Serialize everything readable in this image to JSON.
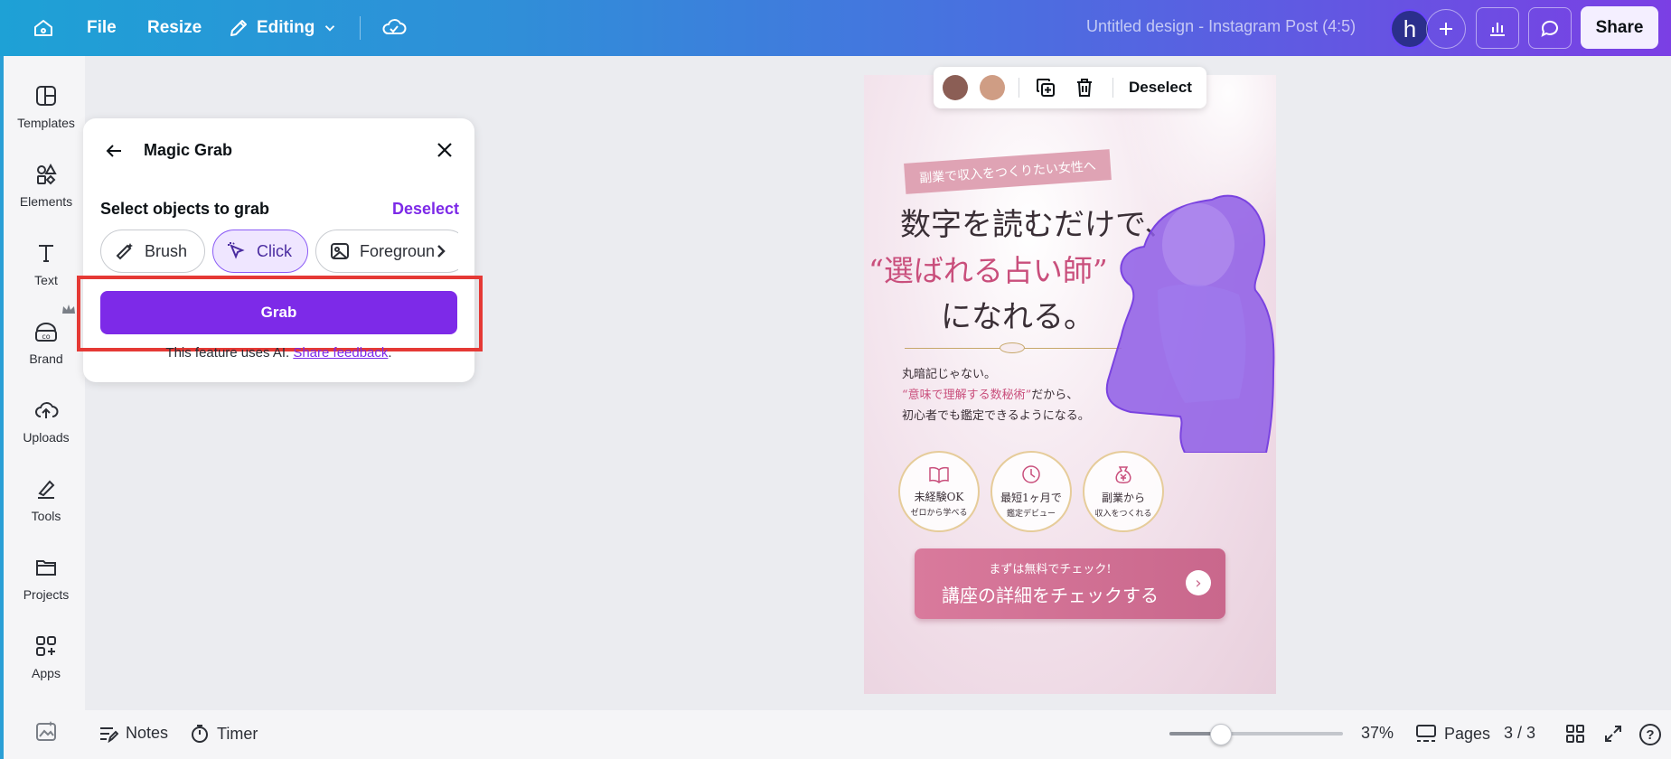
{
  "colors": {
    "accent": "#7d2ae8",
    "highlight_frame": "#e53935",
    "swatch1": "#8b5e55",
    "swatch2": "#cf9d84"
  },
  "topbar": {
    "menu": {
      "file": "File",
      "resize": "Resize",
      "editing": "Editing"
    },
    "design_title": "Untitled design - Instagram Post (4:5)",
    "avatar_initial": "h",
    "share_label": "Share",
    "icons": [
      "home-icon",
      "pencil-icon",
      "chevron-down-icon",
      "cloud-check-icon",
      "plus-icon",
      "analytics-icon",
      "comment-icon"
    ]
  },
  "sidebar": {
    "items": [
      {
        "label": "Templates",
        "icon": "templates-icon"
      },
      {
        "label": "Elements",
        "icon": "elements-icon"
      },
      {
        "label": "Text",
        "icon": "text-icon"
      },
      {
        "label": "Brand",
        "icon": "brand-icon"
      },
      {
        "label": "Uploads",
        "icon": "uploads-icon"
      },
      {
        "label": "Tools",
        "icon": "tools-icon"
      },
      {
        "label": "Projects",
        "icon": "projects-icon"
      },
      {
        "label": "Apps",
        "icon": "apps-icon"
      }
    ]
  },
  "panel": {
    "title": "Magic Grab",
    "subtitle": "Select objects to grab",
    "deselect": "Deselect",
    "tools": {
      "brush": "Brush",
      "click": "Click",
      "foreground": "Foregroun"
    },
    "selected_tool": "Click",
    "grab_label": "Grab",
    "note_prefix": "This feature uses AI. ",
    "note_link": "Share feedback",
    "note_suffix": "."
  },
  "floating_toolbar": {
    "deselect": "Deselect"
  },
  "design": {
    "ribbon": "副業で収入をつくりたい女性へ",
    "headline1": "数字を読むだけで、",
    "headline2": "“選ばれる占い師”",
    "headline3": "になれる。",
    "body1": "丸暗記じゃない。",
    "body2_hl": "“意味で理解する数秘術”",
    "body2_rest": "だから、",
    "body3": "初心者でも鑑定できるようになる。",
    "badges": [
      {
        "title": "未経験OK",
        "sub": "ゼロから学べる"
      },
      {
        "title": "最短1ヶ月で",
        "sub": "鑑定デビュー"
      },
      {
        "title": "副業から",
        "sub": "収入をつくれる"
      }
    ],
    "cta_small": "まずは無料でチェック!",
    "cta_main": "講座の詳細をチェックする",
    "cta_arrow": "›"
  },
  "bottombar": {
    "notes": "Notes",
    "timer": "Timer",
    "zoom": "37%",
    "zoom_fraction": 0.37,
    "pages": "Pages",
    "page_count": "3 / 3",
    "help": "?"
  }
}
